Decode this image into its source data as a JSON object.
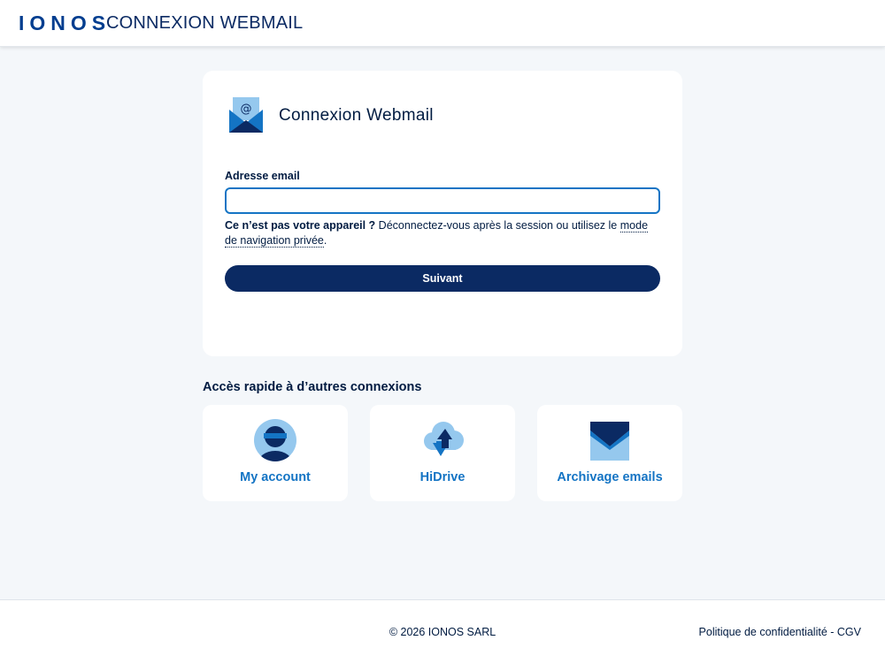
{
  "header": {
    "logo": "IONOS",
    "title": "CONNEXION WEBMAIL"
  },
  "login_card": {
    "icon": "webmail-envelope-icon",
    "title": "Connexion Webmail",
    "email_label": "Adresse email",
    "email_value": "",
    "email_placeholder": "",
    "notice_bold": "Ce n’est pas votre appareil ?",
    "notice_text": " Déconnectez-vous après la session ou utilisez le ",
    "notice_link": "mode de navigation privée",
    "notice_end": ".",
    "next_label": "Suivant"
  },
  "quick_access": {
    "heading": "Accès rapide à d’autres connexions",
    "tiles": [
      {
        "label": "My account",
        "icon": "user-account-icon"
      },
      {
        "label": "HiDrive",
        "icon": "cloud-upload-icon"
      },
      {
        "label": "Archivage emails",
        "icon": "mail-archive-icon"
      }
    ]
  },
  "footer": {
    "copyright": "© 2026 IONOS SARL",
    "privacy_link": "Politique de confidentialité",
    "separator": " - ",
    "terms_link": "CGV"
  },
  "colors": {
    "brand_navy": "#0b2a63",
    "brand_blue": "#1474c4",
    "light_blue": "#95c8ee",
    "page_bg": "#f4f7fa"
  }
}
